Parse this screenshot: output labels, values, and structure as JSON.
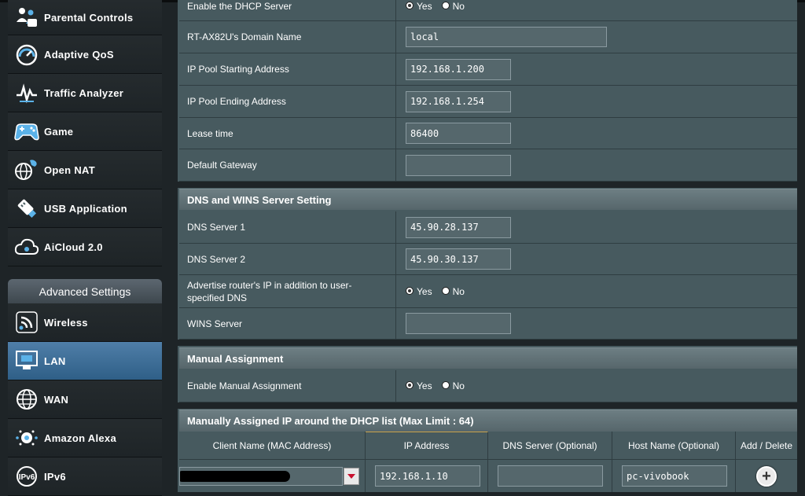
{
  "sidebar": {
    "general_items": [
      {
        "label": "Parental Controls",
        "icon": "parental-controls-icon"
      },
      {
        "label": "Adaptive QoS",
        "icon": "speedometer-icon"
      },
      {
        "label": "Traffic Analyzer",
        "icon": "traffic-analyzer-icon"
      },
      {
        "label": "Game",
        "icon": "gamepad-icon"
      },
      {
        "label": "Open NAT",
        "icon": "open-nat-icon"
      },
      {
        "label": "USB Application",
        "icon": "usb-icon"
      },
      {
        "label": "AiCloud 2.0",
        "icon": "cloud-icon"
      }
    ],
    "advanced_header": "Advanced Settings",
    "advanced_items": [
      {
        "label": "Wireless",
        "icon": "wireless-icon"
      },
      {
        "label": "LAN",
        "icon": "lan-icon",
        "active": true
      },
      {
        "label": "WAN",
        "icon": "globe-icon"
      },
      {
        "label": "Amazon Alexa",
        "icon": "alexa-icon"
      },
      {
        "label": "IPv6",
        "icon": "ipv6-icon"
      }
    ]
  },
  "dhcp": {
    "enable_label": "Enable the DHCP Server",
    "yes": "Yes",
    "no": "No",
    "domain_label": "RT-AX82U's Domain Name",
    "domain_value": "local",
    "pool_start_label": "IP Pool Starting Address",
    "pool_start_value": "192.168.1.200",
    "pool_end_label": "IP Pool Ending Address",
    "pool_end_value": "192.168.1.254",
    "lease_label": "Lease time",
    "lease_value": "86400",
    "gateway_label": "Default Gateway",
    "gateway_value": ""
  },
  "dns": {
    "section_title": "DNS and WINS Server Setting",
    "dns1_label": "DNS Server 1",
    "dns1_value": "45.90.28.137",
    "dns2_label": "DNS Server 2",
    "dns2_value": "45.90.30.137",
    "advertise_label": "Advertise router's IP in addition to user-specified DNS",
    "wins_label": "WINS Server",
    "wins_value": ""
  },
  "manual": {
    "section_title": "Manual Assignment",
    "enable_label": "Enable Manual Assignment"
  },
  "list": {
    "section_title": "Manually Assigned IP around the DHCP list (Max Limit : 64)",
    "columns": [
      "Client Name (MAC Address)",
      "IP Address",
      "DNS Server (Optional)",
      "Host Name (Optional)",
      "Add / Delete"
    ],
    "new_row": {
      "ip": "192.168.1.10",
      "dns": "",
      "host": "pc-vivobook"
    }
  },
  "colors": {
    "panel": "#475a5f",
    "active_nav": "#2f5f87",
    "dropdown_arrow": "#c8102e"
  }
}
